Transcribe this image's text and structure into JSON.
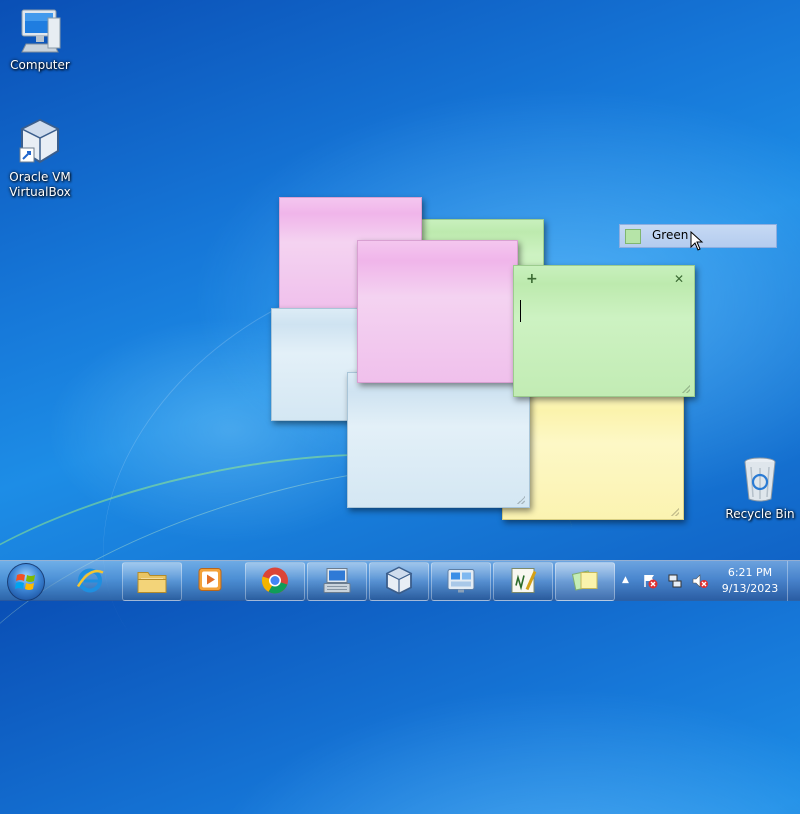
{
  "desktop": {
    "icons": [
      {
        "label": "Computer",
        "icon": "computer-icon"
      },
      {
        "label": "Oracle VM\nVirtualBox",
        "label_line1": "Oracle VM",
        "label_line2": "VirtualBox",
        "icon": "virtualbox-icon"
      },
      {
        "label": "Recycle Bin",
        "icon": "recycle-bin-icon"
      }
    ]
  },
  "sticky_notes": {
    "colors": {
      "pink": "#f2bdec",
      "green": "#c4edb6",
      "blue": "#d8e9f5",
      "yellow": "#fcf5b4"
    },
    "active_note": {
      "add_glyph": "+",
      "close_glyph": "✕",
      "text": ""
    }
  },
  "context_menu": {
    "items": [
      {
        "label": "Green",
        "swatch_color": "#b6e4a8"
      }
    ]
  },
  "taskbar": {
    "start_icon": "windows-start-orb-icon",
    "pinned": [
      {
        "icon": "internet-explorer-icon",
        "active": false
      },
      {
        "icon": "file-explorer-icon",
        "active": true
      },
      {
        "icon": "media-player-icon",
        "active": false
      },
      {
        "icon": "chrome-icon",
        "active": true
      },
      {
        "icon": "on-screen-keyboard-icon",
        "active": true
      },
      {
        "icon": "virtualbox-icon",
        "active": true
      },
      {
        "icon": "control-panel-icon",
        "active": true
      },
      {
        "icon": "math-input-icon",
        "active": true
      },
      {
        "icon": "sticky-notes-icon",
        "active": true
      }
    ],
    "tray": {
      "show_hidden_glyph": "▲",
      "icons": [
        "action-center-icon",
        "network-icon",
        "volume-muted-icon"
      ]
    },
    "clock": {
      "time": "6:21 PM",
      "date": "9/13/2023"
    }
  }
}
